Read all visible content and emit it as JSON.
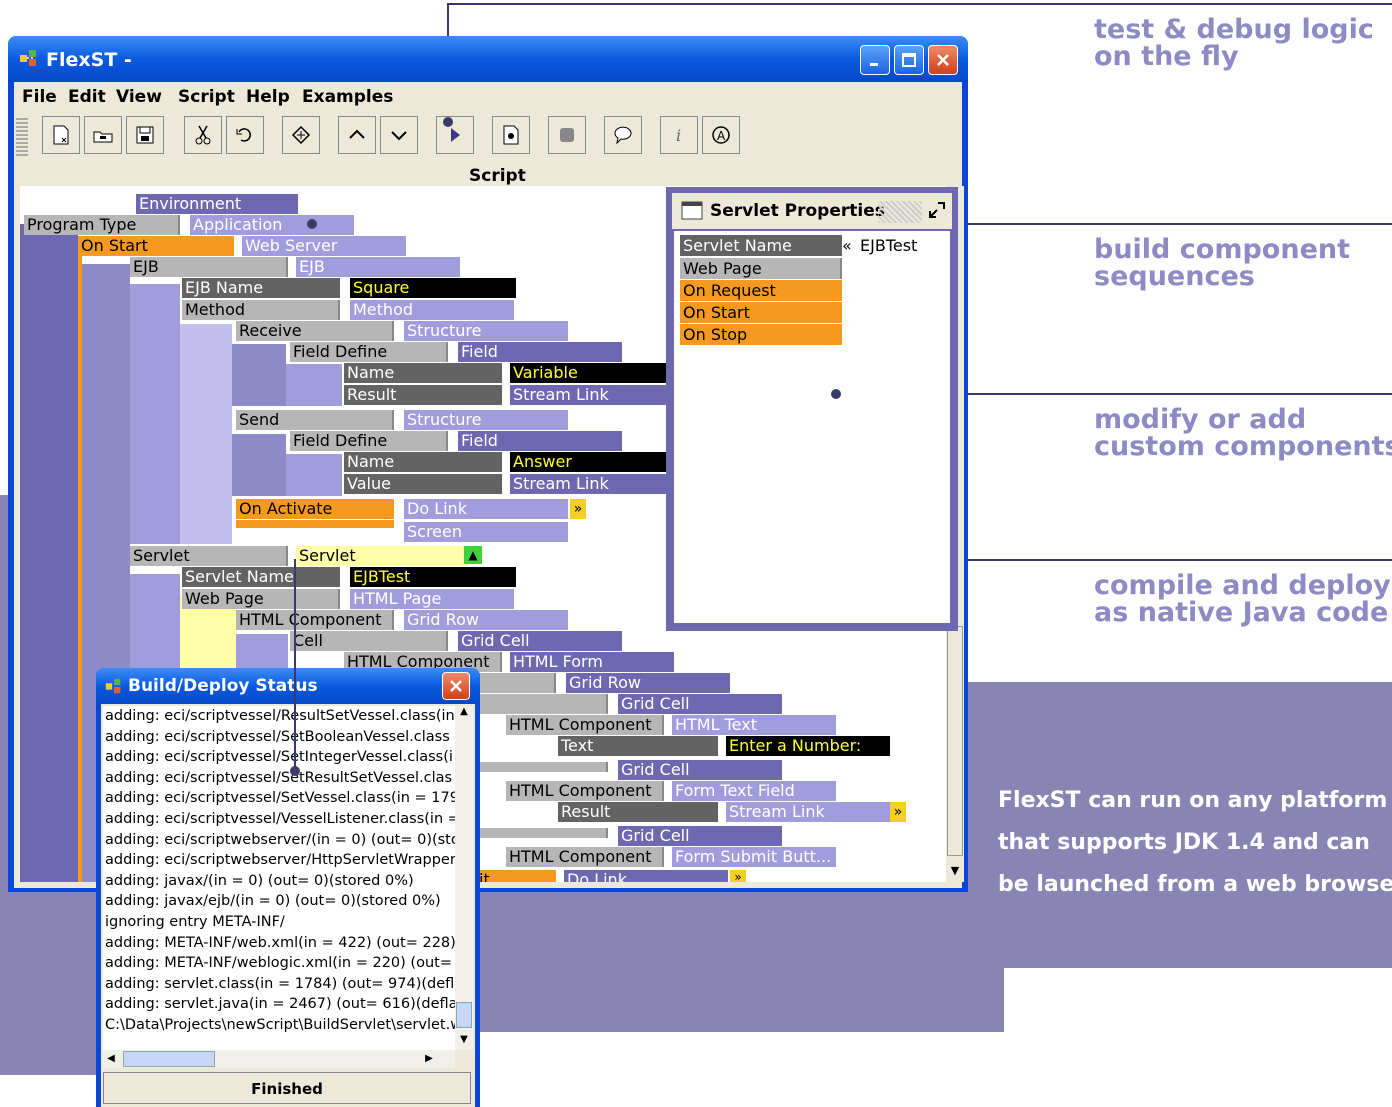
{
  "callouts": {
    "debug": [
      "test & debug logic",
      "on the fly"
    ],
    "sequences": [
      "build component",
      "sequences"
    ],
    "custom": [
      "modify or add",
      "custom components"
    ],
    "compile": [
      "compile and deploy",
      "as native Java code"
    ]
  },
  "promo": [
    "FlexST can run on any platform",
    "that supports JDK 1.4 and can",
    "be launched from a web browser"
  ],
  "window": {
    "title": "FlexST -",
    "menus": [
      "File",
      "Edit",
      "View",
      "Script",
      "Help",
      "Examples"
    ],
    "toolbar_section": "Script",
    "toolbar_icons": [
      "new-file-icon",
      "open-folder-icon",
      "save-icon",
      "cut-icon",
      "rotate-icon",
      "component-icon",
      "move-up-icon",
      "move-down-icon",
      "run-icon",
      "debug-icon",
      "stop-icon",
      "comment-icon",
      "info-icon",
      "about-icon"
    ]
  },
  "tree": {
    "environment": "Environment",
    "program_type": "Program Type",
    "application": "Application",
    "on_start": "On Start",
    "web_server": "Web Server",
    "ejb": "EJB",
    "ejb_type": "EJB",
    "ejb_name": "EJB Name",
    "ejb_name_val": "Square",
    "method": "Method",
    "method_type": "Method",
    "receive": "Receive",
    "structure1": "Structure",
    "field_define1": "Field Define",
    "field1": "Field",
    "name1": "Name",
    "variable": "Variable",
    "result1": "Result",
    "stream_link1": "Stream Link",
    "send": "Send",
    "structure2": "Structure",
    "field_define2": "Field Define",
    "field2": "Field",
    "name2": "Name",
    "answer": "Answer",
    "value": "Value",
    "stream_link2": "Stream Link",
    "on_activate": "On Activate",
    "do_link": "Do Link",
    "screen": "Screen",
    "servlet": "Servlet",
    "servlet_type": "Servlet",
    "servlet_name": "Servlet Name",
    "servlet_name_val": "EJBTest",
    "web_page": "Web Page",
    "html_page": "HTML Page",
    "html_component1": "HTML Component",
    "grid_row1": "Grid Row",
    "cell": "Cell",
    "grid_cell1": "Grid Cell",
    "html_component2": "HTML Component",
    "html_form": "HTML Form",
    "mponent": "mponent",
    "grid_row2": "Grid Row",
    "ll": "ll",
    "grid_cell2": "Grid Cell",
    "html_component3": "HTML Component",
    "html_text": "HTML Text",
    "text": "Text",
    "enter_number": "Enter a Number:",
    "grid_cell3": "Grid Cell",
    "html_component4": "HTML Component",
    "form_text_field": "Form Text Field",
    "result2": "Result",
    "stream_link3": "Stream Link",
    "grid_cell4": "Grid Cell",
    "html_component5": "HTML Component",
    "form_submit": "Form Submit Butt...",
    "it": "it",
    "do_link2": "Do Link"
  },
  "properties": {
    "title": "Servlet Properties",
    "servlet_name_label": "Servlet Name",
    "servlet_name_value": "EJBTest",
    "items": [
      "Web Page",
      "On Request",
      "On Start",
      "On Stop"
    ]
  },
  "build": {
    "title": "Build/Deploy Status",
    "log": [
      "adding: eci/scriptvessel/ResultSetVessel.class(in",
      "adding: eci/scriptvessel/SetBooleanVessel.class",
      "adding: eci/scriptvessel/SetIntegerVessel.class(i",
      "adding: eci/scriptvessel/SetResultSetVessel.clas",
      "adding: eci/scriptvessel/SetVessel.class(in = 179",
      "adding: eci/scriptvessel/VesselListener.class(in =",
      "adding: eci/scriptwebserver/(in = 0) (out= 0)(store",
      "adding: eci/scriptwebserver/HttpServletWrapper.c",
      "adding: javax/(in = 0) (out= 0)(stored 0%)",
      "adding: javax/ejb/(in = 0) (out= 0)(stored 0%)",
      "ignoring entry META-INF/",
      "adding: META-INF/web.xml(in = 422) (out= 228)(de",
      "adding: META-INF/weblogic.xml(in = 220) (out= 16",
      "adding: servlet.class(in = 1784) (out= 974)(deflate",
      "adding: servlet.java(in = 2467) (out= 616)(deflated",
      "C:\\Data\\Projects\\newScript\\BuildServlet\\servlet.wa"
    ],
    "status": "Finished"
  }
}
